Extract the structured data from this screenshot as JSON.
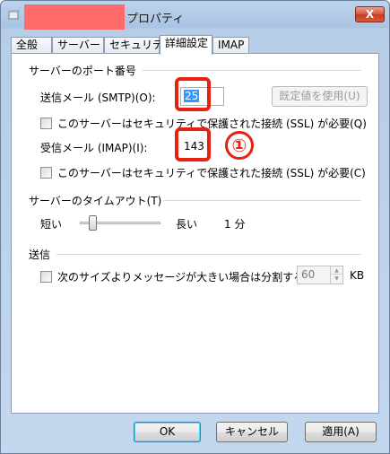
{
  "window": {
    "title_suffix": "プロパティ",
    "close_glyph": "X"
  },
  "tabs": [
    {
      "label": "全般",
      "active": false
    },
    {
      "label": "サーバー",
      "active": false
    },
    {
      "label": "セキュリティ",
      "active": false
    },
    {
      "label": "詳細設定",
      "active": true
    },
    {
      "label": "IMAP",
      "active": false
    }
  ],
  "server_ports": {
    "group_label": "サーバーのポート番号",
    "smtp_label": "送信メール (SMTP)(O):",
    "smtp_value": "25",
    "default_button": "既定値を使用(U)",
    "smtp_ssl_label": "このサーバーはセキュリティで保護された接続 (SSL) が必要(Q)",
    "smtp_ssl_checked": false,
    "imap_label": "受信メール (IMAP)(I):",
    "imap_value": "143",
    "imap_ssl_label": "このサーバーはセキュリティで保護された接続 (SSL) が必要(C)",
    "imap_ssl_checked": false,
    "annotation_mark": "①"
  },
  "timeout": {
    "group_label": "サーバーのタイムアウト(T)",
    "short_label": "短い",
    "long_label": "長い",
    "value_label": "1 分",
    "slider_fraction": 0.12
  },
  "sending": {
    "group_label": "送信",
    "split_label": "次のサイズよりメッセージが大きい場合は分割する(B)",
    "split_checked": false,
    "size_value": "60",
    "unit_label": "KB"
  },
  "buttons": {
    "ok": "OK",
    "cancel": "キャンセル",
    "apply": "適用(A)"
  },
  "colors": {
    "annotation": "#e8200f",
    "redaction": "#ff6b6b",
    "close_button": "#d6533a"
  },
  "icons": {
    "app": "app-icon",
    "spin_up": "spin-up-icon",
    "spin_down": "spin-down-icon"
  }
}
